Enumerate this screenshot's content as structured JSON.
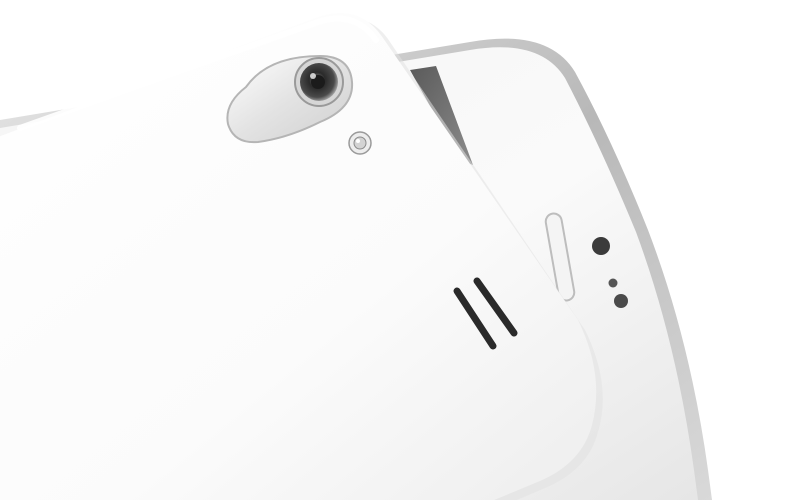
{
  "image": {
    "subject": "phone-front-and-back",
    "colors": {
      "background": "#ffffff",
      "body": "#f7f7f7",
      "shell": "#fbfbfb",
      "bezel_metal": "#c9c9c9",
      "screen_glass": "#6a6a6a",
      "speaker_slot": "#2a2a2a",
      "sensor_dark": "#3b3b3b"
    }
  }
}
